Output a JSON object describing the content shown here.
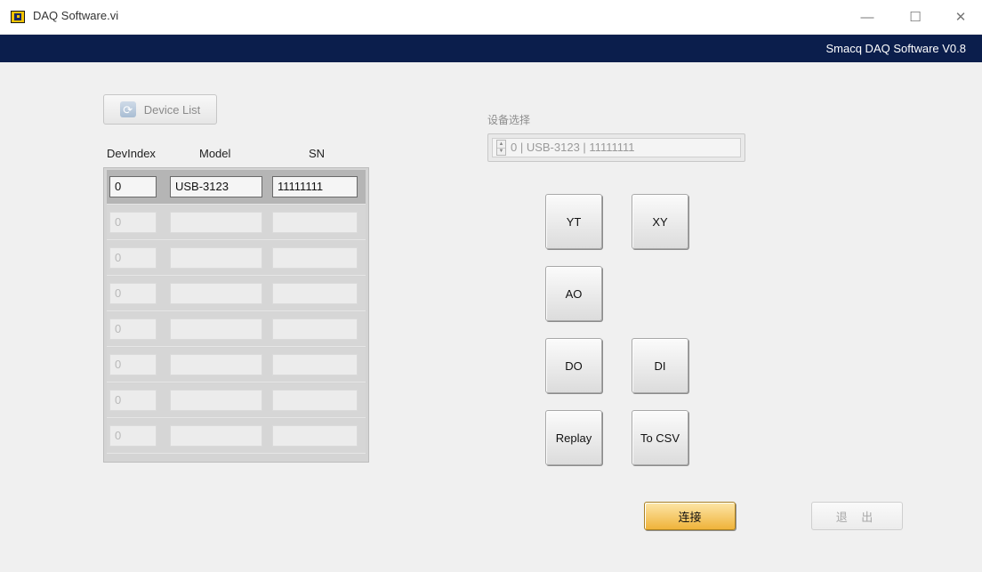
{
  "window": {
    "title": "DAQ Software.vi",
    "min_glyph": "—",
    "max_glyph": "☐",
    "close_glyph": "✕"
  },
  "banner": {
    "text": "Smacq DAQ Software V0.8"
  },
  "device_list_button": {
    "label": "Device List",
    "icon": "refresh-icon"
  },
  "table": {
    "headers": {
      "dev_index": "DevIndex",
      "model": "Model",
      "sn": "SN"
    },
    "rows": [
      {
        "dev_index": "0",
        "model": "USB-3123",
        "sn": "11111111"
      },
      {
        "dev_index": "0",
        "model": "",
        "sn": ""
      },
      {
        "dev_index": "0",
        "model": "",
        "sn": ""
      },
      {
        "dev_index": "0",
        "model": "",
        "sn": ""
      },
      {
        "dev_index": "0",
        "model": "",
        "sn": ""
      },
      {
        "dev_index": "0",
        "model": "",
        "sn": ""
      },
      {
        "dev_index": "0",
        "model": "",
        "sn": ""
      },
      {
        "dev_index": "0",
        "model": "",
        "sn": ""
      }
    ]
  },
  "device_select": {
    "label": "设备选择",
    "value": "0 | USB-3123 | 11111111"
  },
  "buttons": {
    "yt": "YT",
    "xy": "XY",
    "ao": "AO",
    "do": "DO",
    "di": "DI",
    "replay": "Replay",
    "to_csv": "To CSV",
    "connect": "连接",
    "exit": "退 出"
  },
  "colors": {
    "banner_bg": "#0b1e4c",
    "connect_button": "#efb33a",
    "window_bg": "#f0f0f0"
  }
}
